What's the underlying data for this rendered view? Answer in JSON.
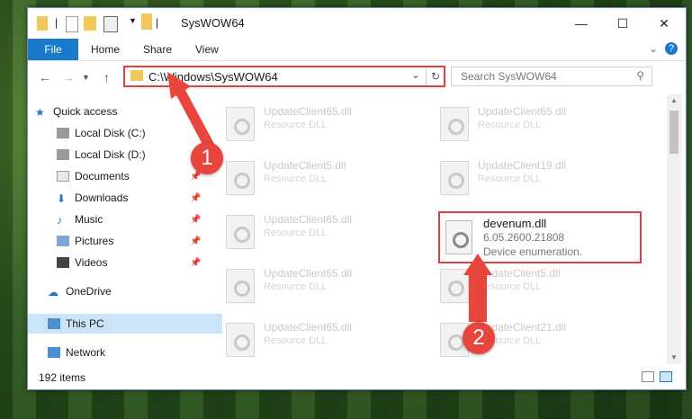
{
  "window": {
    "title": "SysWOW64"
  },
  "ribbon": {
    "file": "File",
    "home": "Home",
    "share": "Share",
    "view": "View"
  },
  "address": {
    "path": "C:\\Windows\\SysWOW64",
    "search_placeholder": "Search SysWOW64"
  },
  "nav": {
    "quick_access": "Quick access",
    "local_c": "Local Disk (C:)",
    "local_d": "Local Disk (D:)",
    "documents": "Documents",
    "downloads": "Downloads",
    "music": "Music",
    "pictures": "Pictures",
    "videos": "Videos",
    "onedrive": "OneDrive",
    "thispc": "This PC",
    "network": "Network"
  },
  "files": [
    {
      "name": "UpdateClient65.dll",
      "type": "Resource DLL"
    },
    {
      "name": "UpdateClient65.dll",
      "type": "Resource DLL"
    },
    {
      "name": "UpdateClient5.dll",
      "type": "Resource DLL"
    },
    {
      "name": "UpdateClient19.dll",
      "type": "Resource DLL"
    },
    {
      "name": "UpdateClient65.dll",
      "type": "Resource DLL"
    },
    {
      "name": "UpdateClient65.dll",
      "type": "Resource DLL"
    },
    {
      "name": "UpdateClient5.dll",
      "type": "Resource DLL"
    },
    {
      "name": "UpdateClient65.dll",
      "type": "Resource DLL"
    },
    {
      "name": "UpdateClient21.dll",
      "type": "Resource DLL"
    }
  ],
  "highlight": {
    "name": "devenum.dll",
    "version": "6.05.2600.21808",
    "desc": "Device enumeration."
  },
  "status": {
    "count": "192 items"
  },
  "callouts": {
    "one": "1",
    "two": "2"
  },
  "colors": {
    "accent": "#1979ca",
    "highlight_red": "#e04040",
    "callout": "#e8453c"
  }
}
